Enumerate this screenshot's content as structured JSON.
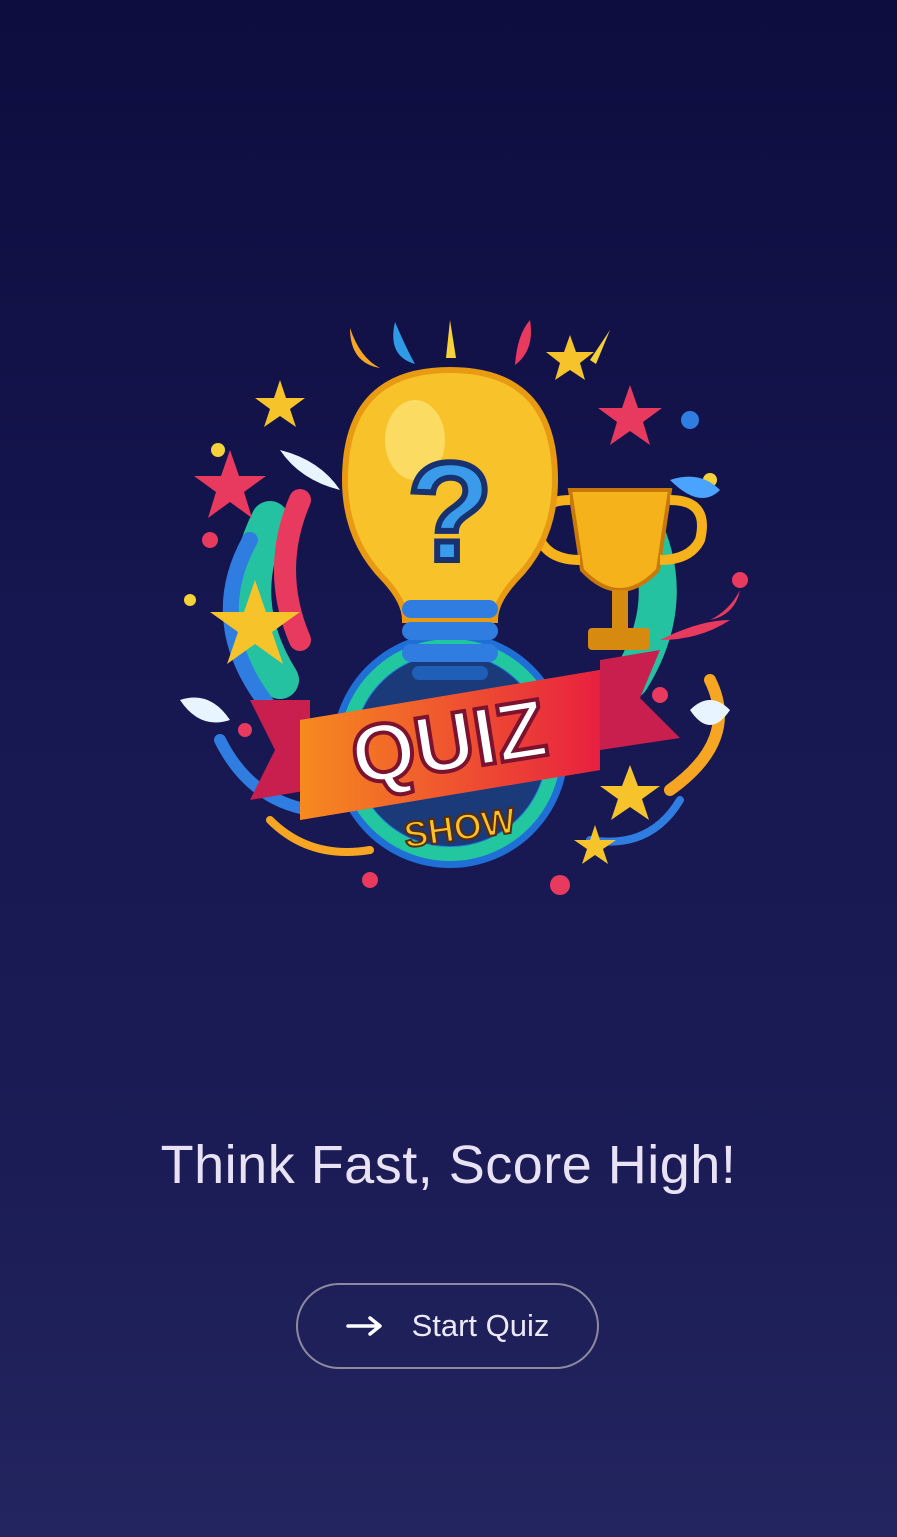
{
  "logo": {
    "banner_text": "QUIZ",
    "sub_text": "SHOW",
    "symbol": "?"
  },
  "tagline": "Think Fast, Score High!",
  "start_button": {
    "label": "Start Quiz",
    "icon": "arrow-right-icon"
  },
  "colors": {
    "background_top": "#0d0d3f",
    "background_bottom": "#232560",
    "text": "#e9e2f5",
    "button_border": "#8d8a9f"
  }
}
